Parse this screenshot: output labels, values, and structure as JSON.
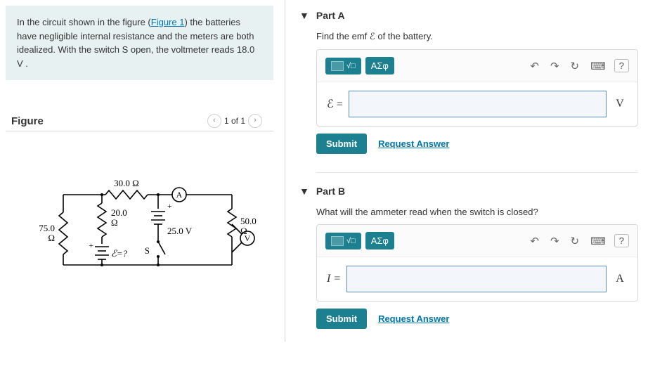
{
  "problem": {
    "text_before_link": "In the circuit shown in the figure (",
    "link_text": "Figure 1",
    "text_after_link": ") the batteries have negligible internal resistance and the meters are both idealized. With the switch S open, the voltmeter reads 18.0 V ."
  },
  "figure": {
    "title": "Figure",
    "counter": "1 of 1"
  },
  "circuit": {
    "R1_label": "30.0 Ω",
    "R2_top": "20.0",
    "R2_bot": "Ω",
    "R3_top": "75.0",
    "R3_bot": "Ω",
    "R4_top": "50.0",
    "R4_bot": "Ω",
    "V_label": "25.0 V",
    "emf_label": "ℰ=?",
    "switch_label": "S",
    "A_label": "A",
    "Vmeter_label": "V",
    "plus_label": "+"
  },
  "parts": [
    {
      "key": "A",
      "title": "Part A",
      "question": "Find the emf ℰ of the battery.",
      "lhs": "ℰ =",
      "unit": "V",
      "greek_label": "ΑΣφ",
      "submit_label": "Submit",
      "request_label": "Request Answer"
    },
    {
      "key": "B",
      "title": "Part B",
      "question": "What will the ammeter read when the switch is closed?",
      "lhs": "I =",
      "unit": "A",
      "greek_label": "ΑΣφ",
      "submit_label": "Submit",
      "request_label": "Request Answer"
    }
  ]
}
